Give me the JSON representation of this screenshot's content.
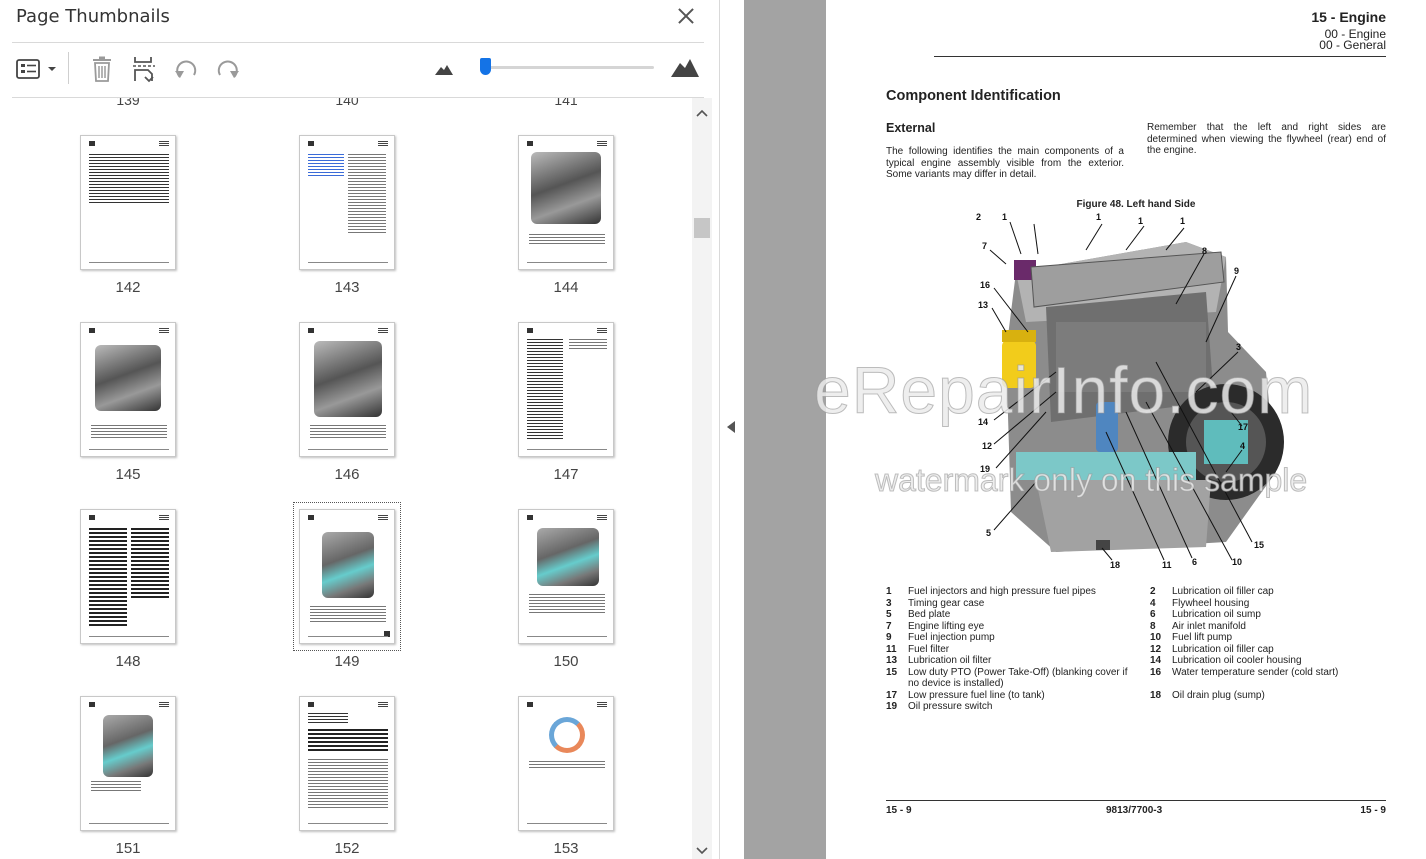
{
  "panel": {
    "title": "Page Thumbnails",
    "cut_labels": [
      "139",
      "140",
      "141"
    ],
    "thumbnails": [
      {
        "label": "142"
      },
      {
        "label": "143"
      },
      {
        "label": "144"
      },
      {
        "label": "145"
      },
      {
        "label": "146"
      },
      {
        "label": "147"
      },
      {
        "label": "148"
      },
      {
        "label": "149"
      },
      {
        "label": "150"
      },
      {
        "label": "151"
      },
      {
        "label": "152"
      },
      {
        "label": "153"
      }
    ],
    "selected_page": "149",
    "toolbar_icons": [
      "options-icon",
      "delete-icon",
      "extract-icon",
      "rotate-left-icon",
      "rotate-right-icon"
    ],
    "zoom_level": 0.02,
    "accent_color": "#1473e6"
  },
  "document": {
    "header": {
      "section": "15 - Engine",
      "sub1": "00 - Engine",
      "sub2": "00 - General"
    },
    "heading": "Component Identification",
    "subheading": "External",
    "para_left": "The following identifies the main components of a typical engine assembly visible from the exterior. Some variants may differ in detail.",
    "para_right": "Remember that the left and right sides are determined when viewing the flywheel (rear) end of the engine.",
    "figure_title": "Figure 48. Left hand Side",
    "callouts": [
      "2",
      "1",
      "1",
      "1",
      "1",
      "7",
      "8",
      "9",
      "16",
      "13",
      "3",
      "14",
      "17",
      "12",
      "4",
      "19",
      "5",
      "18",
      "11",
      "6",
      "10",
      "15"
    ],
    "legend": [
      {
        "num": "1",
        "text": "Fuel injectors and high pressure fuel pipes"
      },
      {
        "num": "2",
        "text": "Lubrication oil filler cap"
      },
      {
        "num": "3",
        "text": "Timing gear case"
      },
      {
        "num": "4",
        "text": "Flywheel housing"
      },
      {
        "num": "5",
        "text": "Bed plate"
      },
      {
        "num": "6",
        "text": "Lubrication oil sump"
      },
      {
        "num": "7",
        "text": "Engine lifting eye"
      },
      {
        "num": "8",
        "text": "Air inlet manifold"
      },
      {
        "num": "9",
        "text": "Fuel injection pump"
      },
      {
        "num": "10",
        "text": "Fuel lift pump"
      },
      {
        "num": "11",
        "text": "Fuel filter"
      },
      {
        "num": "12",
        "text": "Lubrication oil filler cap"
      },
      {
        "num": "13",
        "text": "Lubrication oil filter"
      },
      {
        "num": "14",
        "text": "Lubrication oil cooler housing"
      },
      {
        "num": "15",
        "text": "Low duty PTO (Power Take-Off) (blanking cover if no device is installed)"
      },
      {
        "num": "16",
        "text": "Water temperature sender (cold start)"
      },
      {
        "num": "17",
        "text": "Low pressure fuel line (to tank)"
      },
      {
        "num": "18",
        "text": "Oil drain plug (sump)"
      },
      {
        "num": "19",
        "text": "Oil pressure switch"
      }
    ],
    "footer": {
      "left": "15 - 9",
      "middle": "9813/7700-3",
      "right": "15 - 9"
    }
  },
  "watermark": {
    "line1": "eRepairInfo.com",
    "line2": "watermark only on this sample"
  }
}
